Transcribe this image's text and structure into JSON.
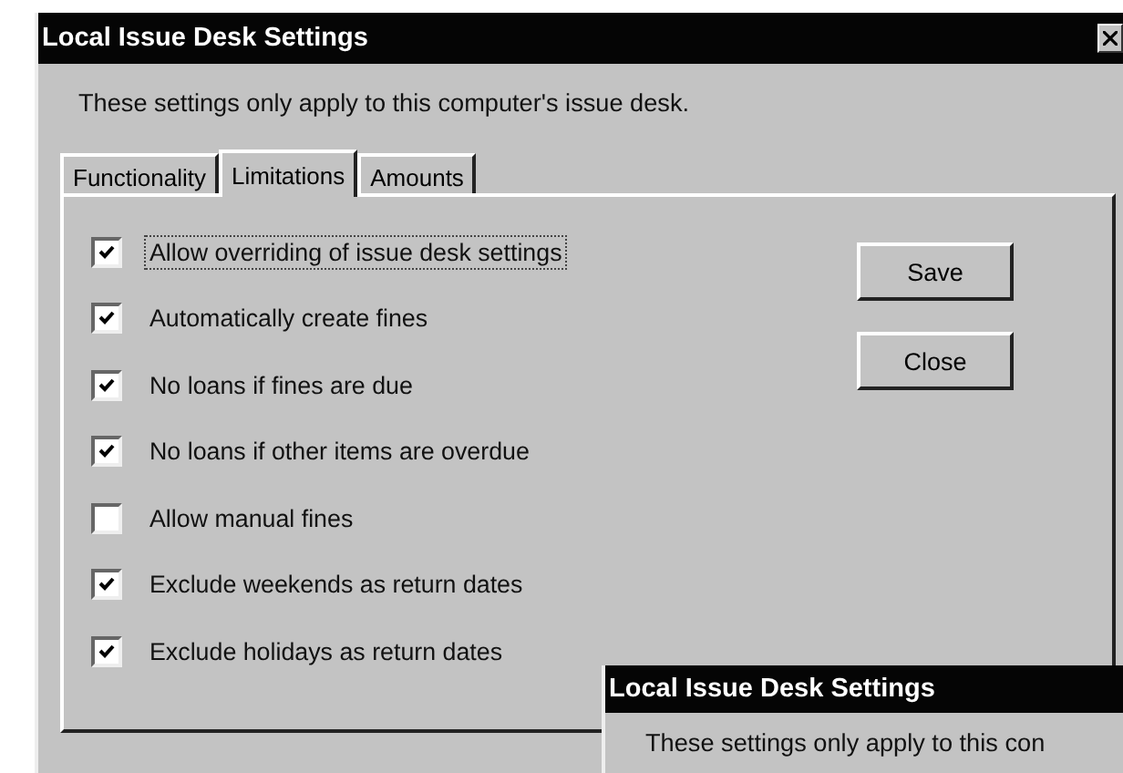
{
  "window": {
    "title": "Local Issue Desk Settings"
  },
  "description": "These settings only apply to this computer's issue desk.",
  "tabs": [
    {
      "label": "Functionality",
      "selected": false
    },
    {
      "label": "Limitations",
      "selected": true
    },
    {
      "label": "Amounts",
      "selected": false
    }
  ],
  "options": [
    {
      "label": "Allow overriding of issue desk settings",
      "checked": true,
      "focused": true
    },
    {
      "label": "Automatically create fines",
      "checked": true,
      "focused": false
    },
    {
      "label": "No loans if fines are due",
      "checked": true,
      "focused": false
    },
    {
      "label": "No loans if other items are overdue",
      "checked": true,
      "focused": false
    },
    {
      "label": "Allow manual fines",
      "checked": false,
      "focused": false
    },
    {
      "label": "Exclude weekends as return dates",
      "checked": true,
      "focused": false
    },
    {
      "label": "Exclude holidays as return dates",
      "checked": true,
      "focused": false
    }
  ],
  "buttons": [
    "Save",
    "Close"
  ],
  "second_window": {
    "title": "Local Issue Desk Settings",
    "description": "These settings only apply to this con"
  }
}
